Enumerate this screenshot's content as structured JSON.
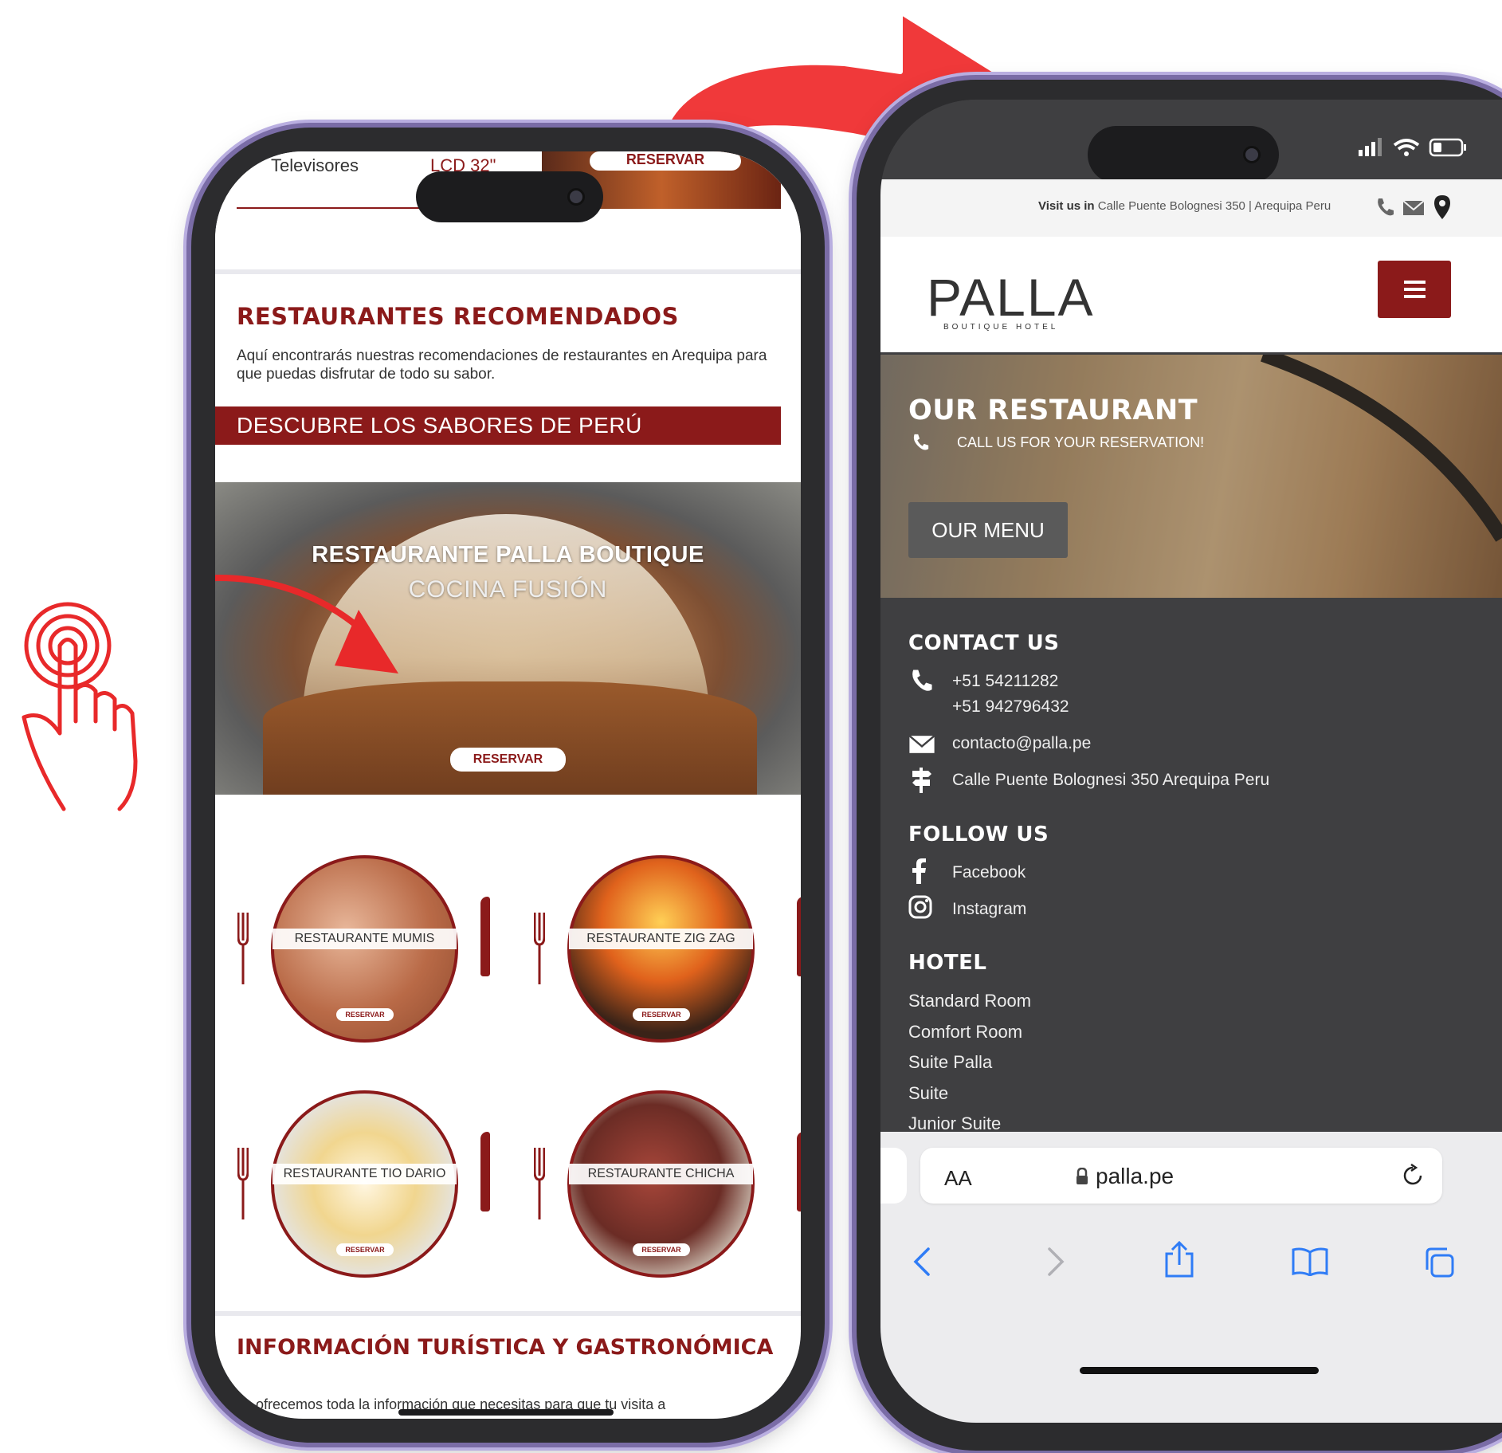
{
  "left_phone": {
    "top_strip": {
      "text_tv": "Televisores",
      "text_lcd": "LCD 32\"",
      "text_reservar": "RESERVAR"
    },
    "section_title": "RESTAURANTES RECOMENDADOS",
    "section_desc": "Aquí encontrarás nuestras recomendaciones de restaurantes en Arequipa para que puedas disfrutar de todo su sabor.",
    "banner": "DESCUBRE LOS SABORES DE PERÚ",
    "hero": {
      "title": "RESTAURANTE PALLA BOUTIQUE",
      "subtitle": "COCINA FUSIÓN",
      "button": "RESERVAR"
    },
    "restaurants": [
      {
        "name": "RESTAURANTE MUMIS",
        "button": "RESERVAR"
      },
      {
        "name": "RESTAURANTE ZIG ZAG",
        "button": "RESERVAR"
      },
      {
        "name": "RESTAURANTE TIO DARIO",
        "button": "RESERVAR"
      },
      {
        "name": "RESTAURANTE CHICHA",
        "button": "RESERVAR"
      }
    ],
    "info_title": "INFORMACIÓN TURÍSTICA Y GASTRONÓMICA",
    "info_text": "Te ofrecemos toda la información que necesitas para que tu visita a"
  },
  "right_phone": {
    "visit_label": "Visit us in",
    "visit_address": "Calle Puente Bolognesi 350 | Arequipa Peru",
    "logo": "PALLA",
    "logo_sub": "BOUTIQUE HOTEL",
    "hero": {
      "title": "OUR RESTAURANT",
      "subtitle": "CALL US FOR YOUR RESERVATION!",
      "button": "OUR MENU"
    },
    "contact": {
      "heading": "CONTACT US",
      "phone1": "+51 54211282",
      "phone2": "+51 942796432",
      "email": "contacto@palla.pe",
      "address": "Calle Puente Bolognesi 350 Arequipa Peru"
    },
    "follow": {
      "heading": "FOLLOW US",
      "facebook": "Facebook",
      "instagram": "Instagram"
    },
    "hotel": {
      "heading": "HOTEL",
      "links": [
        "Standard Room",
        "Comfort Room",
        "Suite Palla",
        "Suite",
        "Junior Suite"
      ]
    },
    "browser": {
      "text_size": "AA",
      "url": "palla.pe"
    }
  },
  "colors": {
    "brand_red": "#8b1a1a",
    "arrow_red": "#f0393a",
    "footer_dark": "#3f3f41"
  }
}
